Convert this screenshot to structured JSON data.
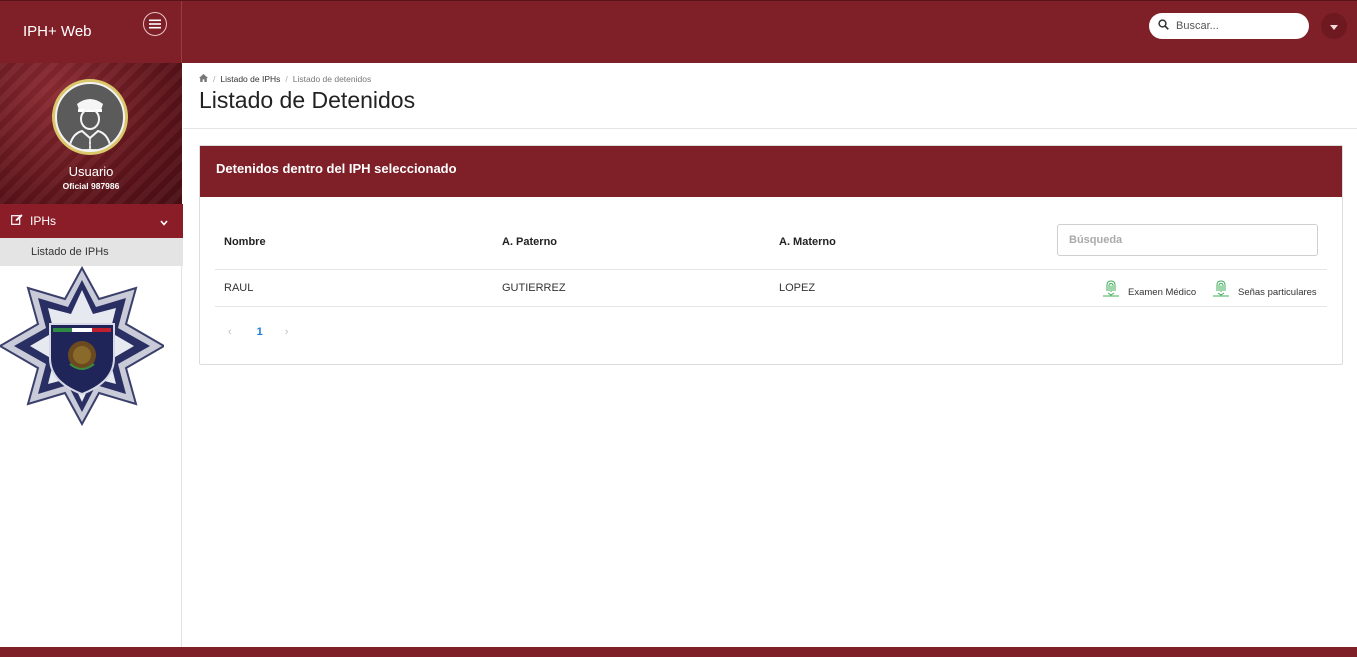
{
  "app": {
    "title": "IPH+ Web"
  },
  "header": {
    "search_placeholder": "Buscar...",
    "menu_icon": "hamburger-menu-icon",
    "dropdown_icon": "caret-down-icon"
  },
  "sidebar": {
    "user_name": "Usuario",
    "user_role": "Oficial 987986",
    "nav_item": {
      "label": "IPHs",
      "icon": "edit-icon"
    },
    "sub_items": [
      {
        "label": "Listado de IPHs"
      }
    ]
  },
  "breadcrumb": {
    "home_icon": "home-icon",
    "items": [
      "Listado de IPHs",
      "Listado de detenidos"
    ]
  },
  "page": {
    "title": "Listado de Detenidos"
  },
  "card": {
    "title": "Detenidos dentro del IPH seleccionado",
    "search_placeholder": "Búsqueda",
    "columns": [
      "Nombre",
      "A. Paterno",
      "A. Materno"
    ],
    "rows": [
      {
        "nombre": "RAUL",
        "paterno": "GUTIERREZ",
        "materno": "LOPEZ",
        "actions": [
          "Examen Médico",
          "Señas particulares"
        ]
      }
    ],
    "pagination": {
      "prev": "‹",
      "current": "1",
      "next": "›"
    }
  },
  "colors": {
    "brand": "#7f1f27",
    "nav_active": "#8b1d28",
    "link": "#1a7ad6",
    "action_icon": "#3fae5a"
  }
}
